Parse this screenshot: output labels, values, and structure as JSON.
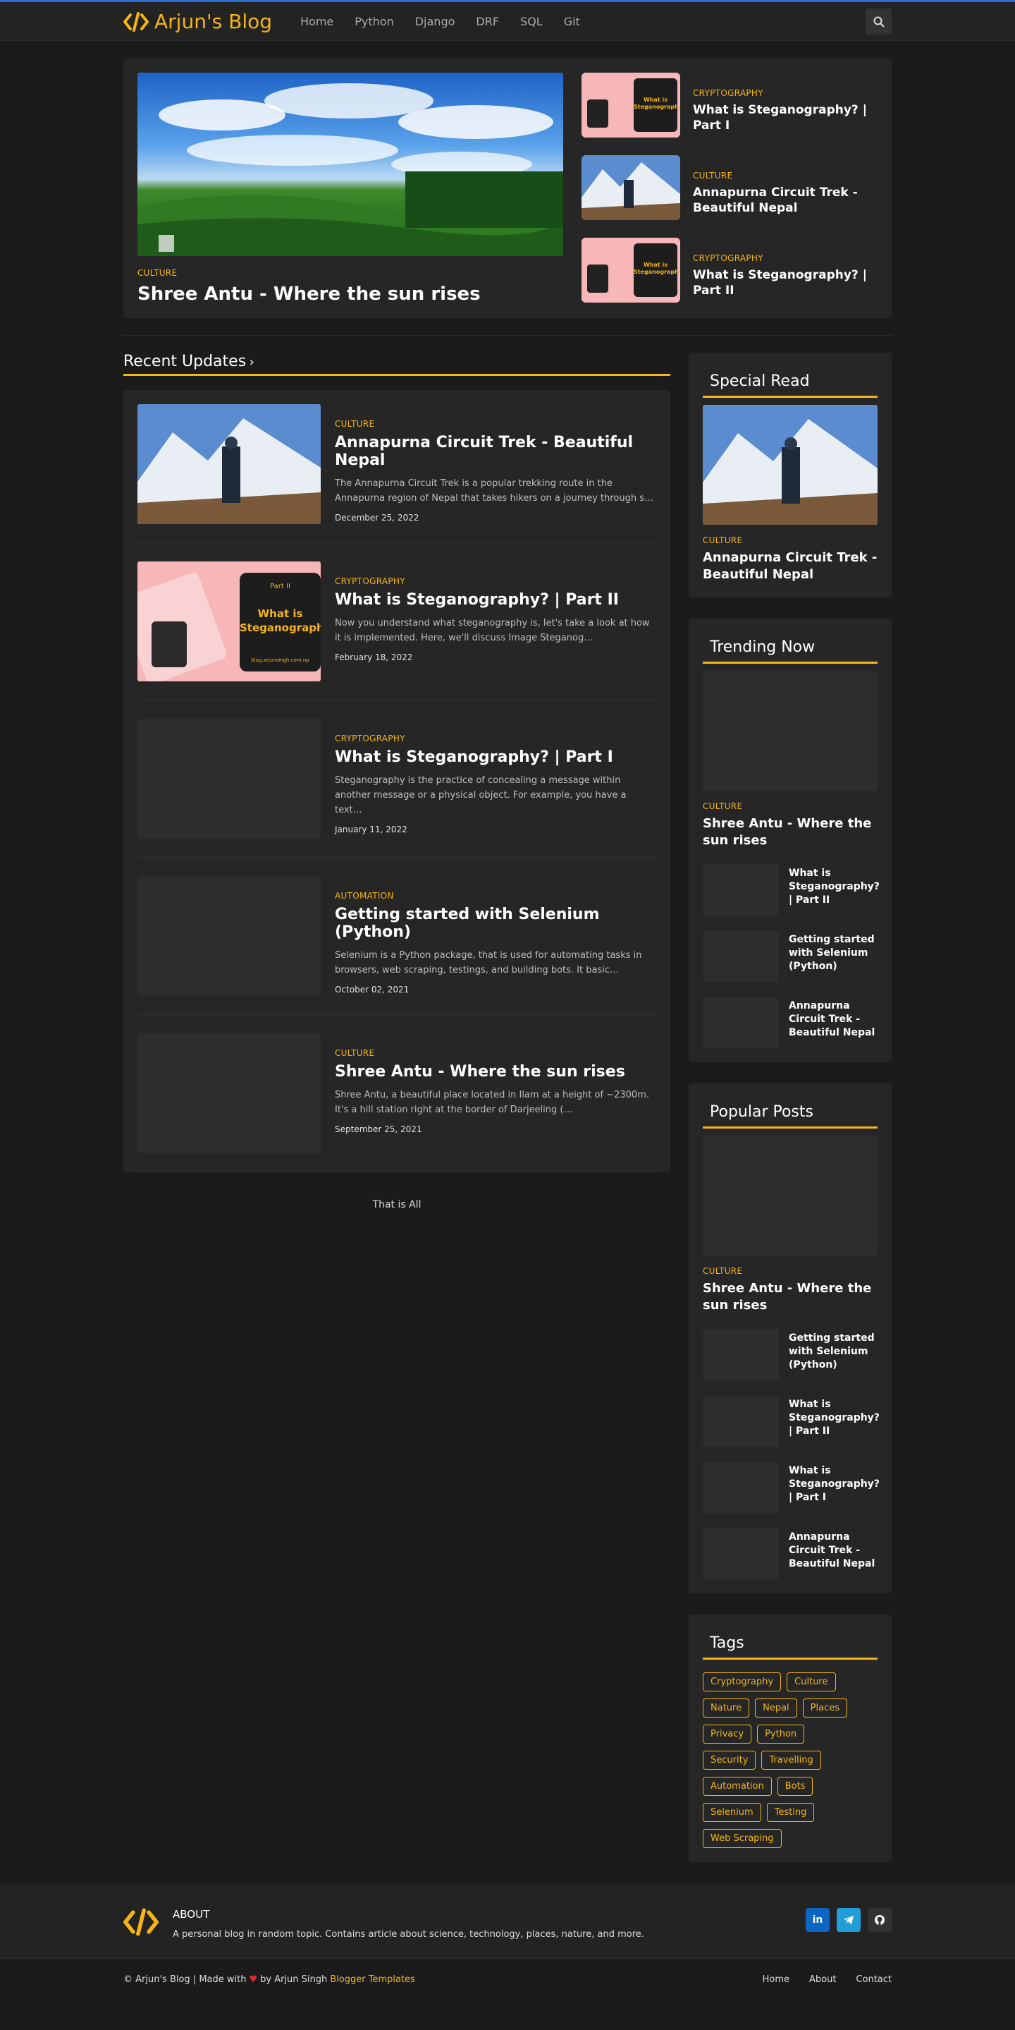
{
  "nav": {
    "brand": "Arjun's Blog",
    "links": [
      "Home",
      "Python",
      "Django",
      "DRF",
      "SQL",
      "Git"
    ]
  },
  "hero": {
    "main": {
      "category": "CULTURE",
      "title": "Shree Antu - Where the sun rises"
    },
    "side": [
      {
        "category": "CRYPTOGRAPHY",
        "title": "What is Steganography? | Part I",
        "thumb_text": "What is Steganography"
      },
      {
        "category": "CULTURE",
        "title": "Annapurna Circuit Trek - Beautiful Nepal"
      },
      {
        "category": "CRYPTOGRAPHY",
        "title": "What is Steganography? | Part II",
        "thumb_text": "What is Steganography"
      }
    ]
  },
  "recent": {
    "heading": "Recent Updates",
    "posts": [
      {
        "category": "CULTURE",
        "title": "Annapurna Circuit Trek - Beautiful Nepal",
        "excerpt": "The Annapurna Circuit Trek is a popular trekking route in the Annapurna region of Nepal that takes hikers on a journey through s…",
        "date": "December 25, 2022"
      },
      {
        "category": "CRYPTOGRAPHY",
        "title": "What is Steganography? | Part II",
        "excerpt": "Now you understand what steganography is, let's take a look at how it is implemented. Here, we'll discuss Image Steganog…",
        "date": "February 18, 2022",
        "thumb_part": "Part II",
        "thumb_text": "What is Steganography",
        "thumb_url": "blog.arjunsingh.com.np"
      },
      {
        "category": "CRYPTOGRAPHY",
        "title": "What is Steganography? | Part I",
        "excerpt": "Steganography  is the practice of concealing a message within another message or a physical object. For example, you have a text…",
        "date": "January 11, 2022"
      },
      {
        "category": "AUTOMATION",
        "title": "Getting started with Selenium (Python)",
        "excerpt": "Selenium is a Python package, that is used for automating tasks in browsers, web scraping, testings, and building bots. It basic…",
        "date": "October 02, 2021"
      },
      {
        "category": "CULTURE",
        "title": "Shree Antu - Where the sun rises",
        "excerpt": "Shree Antu, a beautiful place located in Ilam at a height of ~2300m. It's a hill station right at the border of Darjeeling (…",
        "date": "September 25, 2021"
      }
    ],
    "end_text": "That is All"
  },
  "special": {
    "heading": "Special Read",
    "category": "CULTURE",
    "title": "Annapurna Circuit Trek - Beautiful Nepal"
  },
  "trending": {
    "heading": "Trending Now",
    "featured": {
      "category": "CULTURE",
      "title": "Shree Antu - Where the sun rises"
    },
    "items": [
      "What is Steganography? | Part II",
      "Getting started with Selenium (Python)",
      "Annapurna Circuit Trek - Beautiful Nepal"
    ]
  },
  "popular": {
    "heading": "Popular Posts",
    "featured": {
      "category": "CULTURE",
      "title": "Shree Antu - Where the sun rises"
    },
    "items": [
      "Getting started with Selenium (Python)",
      "What is Steganography? | Part II",
      "What is Steganography? | Part I",
      "Annapurna Circuit Trek - Beautiful Nepal"
    ]
  },
  "tags": {
    "heading": "Tags",
    "items": [
      "Cryptography",
      "Culture",
      "Nature",
      "Nepal",
      "Places",
      "Privacy",
      "Python",
      "Security",
      "Travelling",
      "Automation",
      "Bots",
      "Selenium",
      "Testing",
      "Web Scraping"
    ]
  },
  "footer": {
    "about_title": "ABOUT",
    "about_text": "A personal blog in random topic. Contains article about science, technology, places, nature, and more.",
    "copyright_prefix": "© Arjun's Blog | Made with",
    "copyright_mid": "by Arjun Singh",
    "copyright_link": "Blogger Templates",
    "links": [
      "Home",
      "About",
      "Contact"
    ],
    "social_icons": [
      "linkedin-icon",
      "telegram-icon",
      "github-icon"
    ]
  },
  "colors": {
    "accent": "#f5b417",
    "background": "#1b1b1b",
    "card": "#262626"
  }
}
